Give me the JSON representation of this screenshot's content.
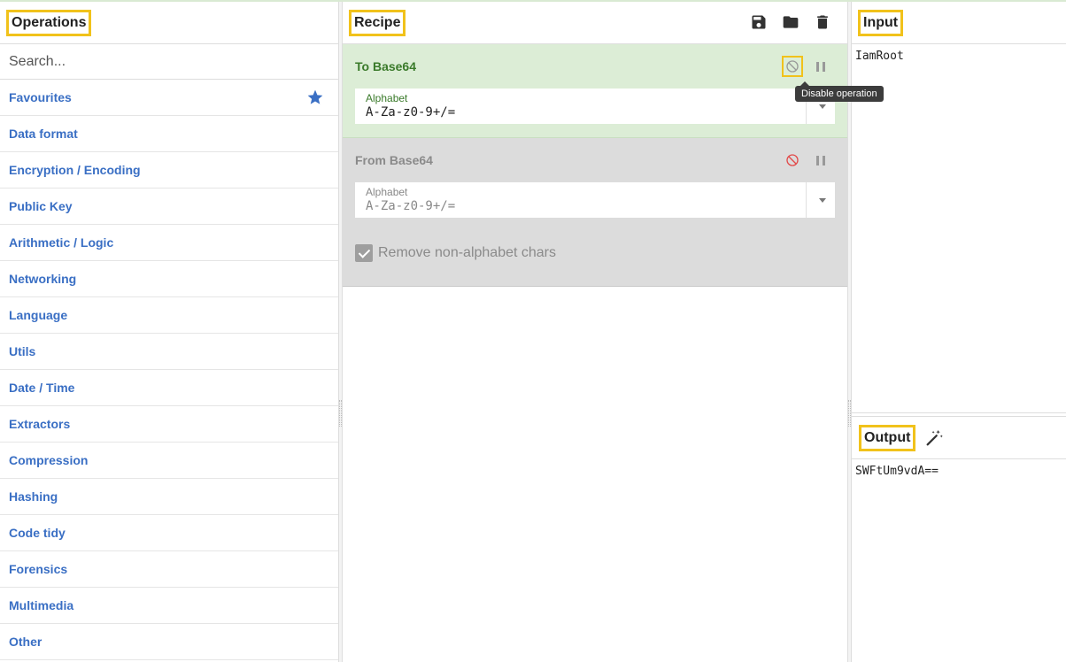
{
  "operations": {
    "title": "Operations",
    "search_placeholder": "Search...",
    "categories": [
      "Favourites",
      "Data format",
      "Encryption / Encoding",
      "Public Key",
      "Arithmetic / Logic",
      "Networking",
      "Language",
      "Utils",
      "Date / Time",
      "Extractors",
      "Compression",
      "Hashing",
      "Code tidy",
      "Forensics",
      "Multimedia",
      "Other"
    ]
  },
  "recipe": {
    "title": "Recipe",
    "tooltip": "Disable operation",
    "ops": [
      {
        "name": "To Base64",
        "state": "enabled",
        "field_label": "Alphabet",
        "field_value": "A-Za-z0-9+/="
      },
      {
        "name": "From Base64",
        "state": "disabled",
        "field_label": "Alphabet",
        "field_value": "A-Za-z0-9+/=",
        "checkbox_label": "Remove non-alphabet chars"
      }
    ]
  },
  "io": {
    "input_title": "Input",
    "input_text": "IamRoot",
    "output_title": "Output",
    "output_text": "SWFtUm9vdA=="
  },
  "colors": {
    "highlight": "#f1c21b",
    "link_blue": "#3a6fc4",
    "enabled_bg": "#dcedd6",
    "disabled_bg": "#dcdcdc",
    "disable_icon_red": "#e24a4a"
  }
}
